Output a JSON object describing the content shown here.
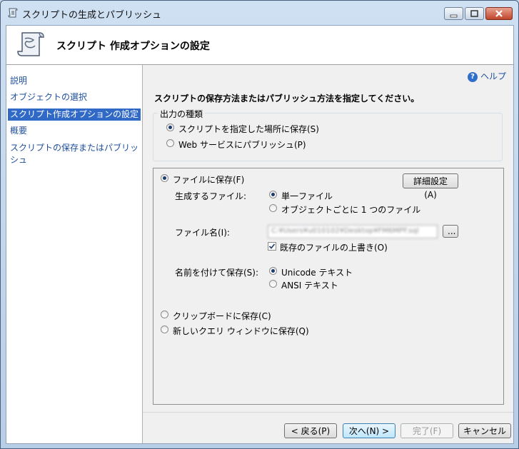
{
  "window": {
    "title": "スクリプトの生成とパブリッシュ"
  },
  "header": {
    "title": "スクリプト 作成オプションの設定"
  },
  "nav": {
    "items": [
      "説明",
      "オブジェクトの選択",
      "スクリプト作成オプションの設定",
      "概要",
      "スクリプトの保存またはパブリッシュ"
    ],
    "selected_index": 2
  },
  "main": {
    "help": "ヘルプ",
    "instruction": "スクリプトの保存方法またはパブリッシュ方法を指定してください。",
    "output_type": {
      "label": "出力の種類",
      "options": [
        "スクリプトを指定した場所に保存(S)",
        "Web サービスにパブリッシュ(P)"
      ],
      "selected_index": 0
    },
    "save_to_file": {
      "label": "ファイルに保存(F)",
      "selected": true,
      "advanced_button": "詳細設定(A)",
      "files_label": "生成するファイル:",
      "files_options": [
        "単一ファイル",
        "オブジェクトごとに 1 つのファイル"
      ],
      "files_selected_index": 0,
      "filename_label": "ファイル名(I):",
      "filename_value": "C:¥Users¥u010102¥Desktop¥FM6MPF.sql",
      "browse_button": "...",
      "overwrite_label": "既存のファイルの上書き(O)",
      "overwrite_checked": true,
      "save_as_label": "名前を付けて保存(S):",
      "save_as_options": [
        "Unicode テキスト",
        "ANSI テキスト"
      ],
      "save_as_selected_index": 0
    },
    "clipboard": "クリップボードに保存(C)",
    "query_window": "新しいクエリ ウィンドウに保存(Q)"
  },
  "footer": {
    "back": "< 戻る(P)",
    "next": "次へ(N) >",
    "finish": "完了(F)",
    "cancel": "キャンセル"
  }
}
